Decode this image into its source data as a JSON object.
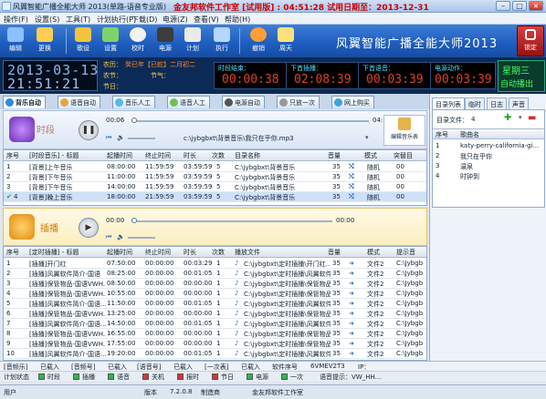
{
  "window": {
    "title": "风翼智能广播全能大师 2013(单路-语音专业版)",
    "highlight": "金友邦软件工作室  [试用版] : 04:51:28 试用日期至：2013-12-31"
  },
  "menu": [
    "操作(F)",
    "设置(S)",
    "工具(T)",
    "计划执行(P)",
    "下载(D)",
    "电源(Z)",
    "查看(V)",
    "帮助(H)"
  ],
  "toolbar": [
    "编辑",
    "更换",
    "歌设",
    "设置",
    "校时",
    "电源",
    "计划",
    "执行",
    "撤销",
    "周天"
  ],
  "brand": "风翼智能广播全能大师2013",
  "lock_label": "锁定",
  "clock": {
    "date": "2013-03-13",
    "time": "21:51:21"
  },
  "calendar": {
    "nongli_label": "农历：",
    "nongli_value": "癸巳年【已蛇】二月初二",
    "nongli2_label": "农节：",
    "jieqi_label": "节气：",
    "festival_label": "节日："
  },
  "countdowns": [
    {
      "label": "时段结束：",
      "value": "00:00:38"
    },
    {
      "label": "下首插播：",
      "value": "02:08:39"
    },
    {
      "label": "下首语音：",
      "value": "00:03:39"
    },
    {
      "label": "电源动作：",
      "value": "00:03:39"
    }
  ],
  "weekday": "星期三",
  "auto_mode": "自动播出",
  "tabs": [
    "背乐自动",
    "语音自动",
    "音乐人工",
    "语音人工",
    "电源自动",
    "只放一次",
    "网上购买"
  ],
  "player1": {
    "label": "时段",
    "elapsed": "00:06",
    "total": "04:15",
    "file": "c:\\jybgbxt\\背景音乐\\我只在乎你.mp3",
    "edit_btn": "编辑音乐表"
  },
  "grid1": {
    "headers": [
      "序号",
      "[时段音乐] - 标题",
      "起播时间",
      "终止时间",
      "时长",
      "次数",
      "目录名称",
      "音量",
      "模式",
      "突替目"
    ],
    "rows": [
      [
        "1",
        "[背景]上午音乐",
        "08:00:00",
        "11:59:59",
        "03:59:59",
        "5",
        "C:\\jybgbxt\\背景音乐",
        "35",
        "随机",
        "00"
      ],
      [
        "2",
        "[背景]下午音乐",
        "11:00:00",
        "11:59:59",
        "03:59:59",
        "5",
        "C:\\jybgbxt\\背景音乐",
        "35",
        "随机",
        "00"
      ],
      [
        "3",
        "[背景]下午音乐",
        "14:00:00",
        "11:59:59",
        "03:59:59",
        "5",
        "C:\\jybgbxt\\背景音乐",
        "35",
        "随机",
        "00"
      ],
      [
        "4",
        "[背景]晚上音乐",
        "18:00:00",
        "21:59:59",
        "03:59:59",
        "5",
        "C:\\jybgbxt\\背景音乐",
        "35",
        "随机",
        "00"
      ]
    ]
  },
  "player2": {
    "label": "插播",
    "elapsed": "00:00",
    "total": "00:00"
  },
  "grid2": {
    "headers": [
      "序号",
      "[定时插播] - 标题",
      "起播时间",
      "终止时间",
      "时长",
      "次数",
      "播放文件",
      "音量",
      "",
      "模式",
      "提示音"
    ],
    "rows": [
      [
        "1",
        "[插播]开门红",
        "07:50:00",
        "00:00:00",
        "00:03:29",
        "1",
        "C:\\jybgbxt\\定时插播\\开门红...",
        "35",
        "文件2",
        "C:\\Jybgb"
      ],
      [
        "2",
        "[插播]风翼软件简介-国语",
        "08:25:00",
        "00:00:00",
        "00:01:05",
        "1",
        "C:\\jybgbxt\\定时插播\\风翼软件...",
        "35",
        "文件2",
        "C:\\Jybgb"
      ],
      [
        "3",
        "[插播]保管物品-国语VWH...",
        "08:50:00",
        "00:00:00",
        "00:00:00",
        "1",
        "C:\\jybgbxt\\定时插播\\保管物品...",
        "35",
        "文件2",
        "C:\\Jybgb"
      ],
      [
        "4",
        "[插播]保管物品-国语VWH...",
        "10:55:00",
        "00:00:00",
        "00:00:00",
        "1",
        "C:\\jybgbxt\\定时插播\\保管物品...",
        "35",
        "文件2",
        "C:\\Jybgb"
      ],
      [
        "5",
        "[插播]风翼软件简介-国语...",
        "11:50:00",
        "00:00:00",
        "00:01:05",
        "1",
        "C:\\jybgbxt\\定时插播\\风翼软件...",
        "35",
        "文件2",
        "C:\\Jybgb"
      ],
      [
        "6",
        "[插播]保管物品-国语VWH...",
        "13:25:00",
        "00:00:00",
        "00:00:00",
        "1",
        "C:\\jybgbxt\\定时插播\\保管物品...",
        "35",
        "文件2",
        "C:\\Jybgb"
      ],
      [
        "7",
        "[插播]风翼软件简介-国语...",
        "14:50:00",
        "00:00:00",
        "00:01:05",
        "1",
        "C:\\jybgbxt\\定时插播\\风翼软件...",
        "35",
        "文件2",
        "C:\\Jybgb"
      ],
      [
        "8",
        "[插播]保管物品-国语VWH...",
        "16:55:00",
        "00:00:00",
        "00:00:00",
        "1",
        "C:\\jybgbxt\\定时插播\\保管物品...",
        "35",
        "文件2",
        "C:\\Jybgb"
      ],
      [
        "9",
        "[插播]保管物品-国语VWH...",
        "17:55:00",
        "00:00:00",
        "00:00:00",
        "1",
        "C:\\jybgbxt\\定时插播\\保管物品...",
        "35",
        "文件2",
        "C:\\Jybgb"
      ],
      [
        "10",
        "[插播]风翼软件简介-国语...",
        "19:20:00",
        "00:00:00",
        "00:01:05",
        "1",
        "C:\\jybgbxt\\定时插播\\风翼软件...",
        "35",
        "文件2",
        "C:\\Jybgb"
      ]
    ]
  },
  "right": {
    "tabs": [
      "目录列表",
      "临时",
      "日志",
      "声音"
    ],
    "file_count_label": "目录文件：",
    "file_count": "4",
    "headers": [
      "序号",
      "歌曲名"
    ],
    "songs": [
      [
        "1",
        "katy-perry-california-gi..."
      ],
      [
        "2",
        "我只在乎你"
      ],
      [
        "3",
        "温泉"
      ],
      [
        "4",
        "时钟到"
      ]
    ]
  },
  "bottom1": [
    "[音频乐]",
    "已载入",
    "[音频号]",
    "已载入",
    "[语音号]",
    "已载入",
    "[一次表]",
    "已载入",
    "软件序号",
    "6VMEV2T3",
    "IP："
  ],
  "bottom2": [
    "计划状态",
    "时段",
    "插播",
    "语音",
    "关机",
    "报时",
    "节日",
    "电源",
    "一次",
    "语音提示：VW_HH..."
  ],
  "bottom3": {
    "user_label": "用户",
    "version_label": "版本",
    "version": "7.2.0.8",
    "maker_label": "制造商",
    "maker": "金友邦软件工作室"
  },
  "colors": {
    "toolbar_blue": "#1d5cbd",
    "status_dark": "#0b2a55",
    "lcd_red": "#d9442b",
    "lcd_green": "#44ff66"
  }
}
